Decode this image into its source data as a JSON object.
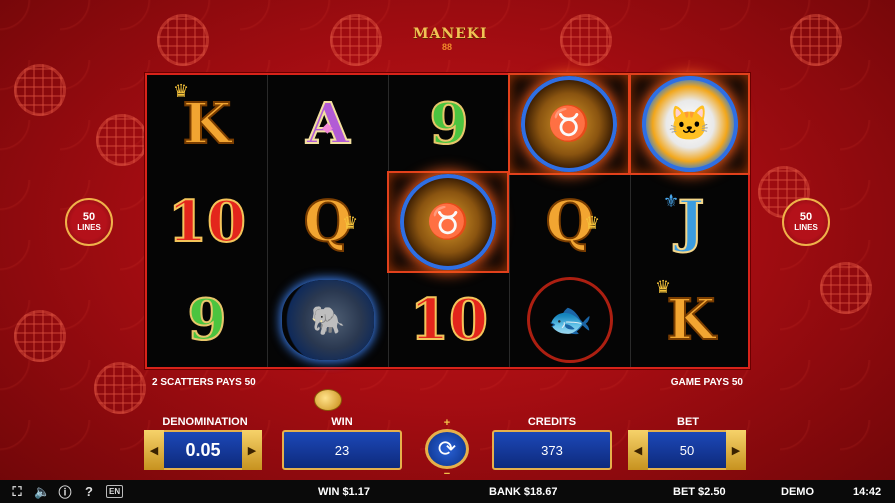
{
  "logo": {
    "title": "MANEKI",
    "subtitle": "88"
  },
  "lines_badge": {
    "count": "50",
    "label": "LINES"
  },
  "reels": {
    "columns": [
      [
        "K",
        "10",
        "9"
      ],
      [
        "A",
        "Q",
        "elephant"
      ],
      [
        "9",
        "bull",
        "10"
      ],
      [
        "bull",
        "Q",
        "koi"
      ],
      [
        "cat",
        "J",
        "K"
      ]
    ]
  },
  "info": {
    "scatters": "2 SCATTERS PAYS 50",
    "game_pays": "GAME PAYS 50"
  },
  "controls": {
    "denomination_label": "DENOMINATION",
    "denomination_value": "0.05",
    "win_label": "WIN",
    "win_value": "23",
    "credits_label": "CREDITS",
    "credits_value": "373",
    "bet_label": "BET",
    "bet_value": "50",
    "spin_plus": "+",
    "spin_minus": "−"
  },
  "bottom_bar": {
    "win": "WIN $1.17",
    "bank": "BANK $18.67",
    "bet": "BET $2.50",
    "mode": "DEMO",
    "time": "14:42",
    "language": "EN"
  },
  "colors": {
    "background": "#b3101a",
    "reel_border": "#d8231a",
    "panel_blue": "#1c48b8",
    "gold": "#e6b04a"
  },
  "icons": [
    "fullscreen-icon",
    "sound-icon",
    "info-icon",
    "help-icon",
    "spin-icon",
    "arrow-left-icon",
    "arrow-right-icon"
  ]
}
